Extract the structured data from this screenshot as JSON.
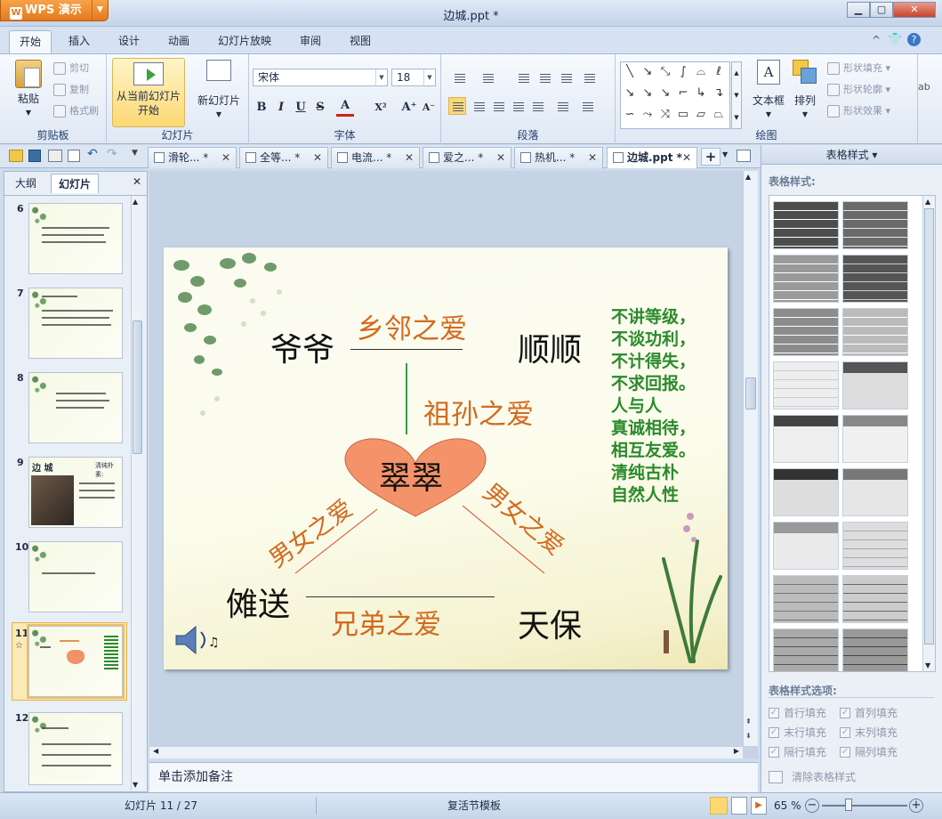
{
  "app": {
    "name": "WPS 演示",
    "doc_title": "边城.ppt *"
  },
  "ribbon_tabs": [
    "开始",
    "插入",
    "设计",
    "动画",
    "幻灯片放映",
    "审阅",
    "视图"
  ],
  "clipboard": {
    "paste": "粘贴",
    "cut": "剪切",
    "copy": "复制",
    "format_painter": "格式刷",
    "label": "剪贴板"
  },
  "slides_group": {
    "play_from_current": "从当前幻灯片开始",
    "new_slide": "新幻灯片",
    "label": "幻灯片"
  },
  "font": {
    "name": "宋体",
    "size": "18",
    "label": "字体",
    "bold": "B",
    "italic": "I",
    "underline": "U",
    "strike": "S",
    "font_color": "A",
    "superscript": "X²",
    "grow": "A⁺",
    "shrink": "A⁻"
  },
  "paragraph": {
    "label": "段落"
  },
  "drawing": {
    "textbox": "文本框",
    "arrange": "排列",
    "shape_fill": "形状填充",
    "shape_outline": "形状轮廓",
    "shape_effect": "形状效果",
    "label": "绘图"
  },
  "doc_tabs": [
    "滑轮... *",
    "全等... *",
    "电流... *",
    "爱之... *",
    "热机... *",
    "边城.ppt *"
  ],
  "left_panel": {
    "tabs": [
      "大纲",
      "幻灯片"
    ],
    "slides": [
      "6",
      "7",
      "8",
      "9",
      "10",
      "11",
      "12"
    ],
    "slide9_title": "边 城",
    "slide9_note": "清纯朴素:"
  },
  "slide": {
    "grandpa": "爷爷",
    "shunshun": "顺顺",
    "cuicui": "翠翠",
    "nuosong": "傩送",
    "tianbao": "天保",
    "neighbor_love": "乡邻之爱",
    "grandchild_love": "祖孙之爱",
    "romance": "男女之爱",
    "brother_love": "兄弟之爱",
    "qualities": [
      "不讲等级，",
      "不谈功利，",
      "不计得失，",
      "不求回报。",
      "人与人",
      "真诚相待，",
      "相互友爱。",
      "清纯古朴",
      "自然人性"
    ]
  },
  "notes_placeholder": "单击添加备注",
  "right_pane": {
    "title": "表格样式",
    "styles_label": "表格样式:",
    "options_label": "表格样式选项:",
    "options": [
      "首行填充",
      "首列填充",
      "末行填充",
      "末列填充",
      "隔行填充",
      "隔列填充"
    ],
    "clear": "清除表格样式"
  },
  "status": {
    "slide_pos": "幻灯片 11 / 27",
    "template": "复活节模板",
    "zoom": "65 %"
  }
}
